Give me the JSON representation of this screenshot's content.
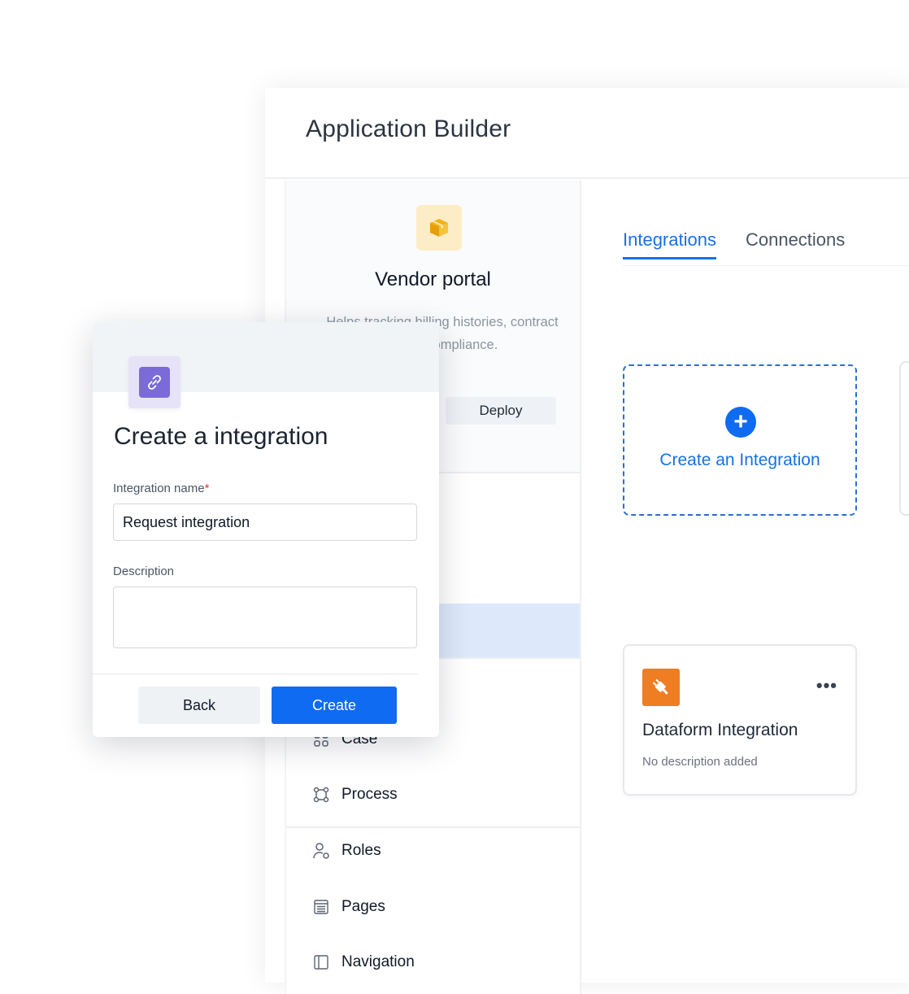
{
  "app": {
    "title": "Application Builder",
    "name": "Vendor portal",
    "description": "Helps tracking billing histories, contract ... Regulatory Compliance.",
    "description_line1": "Helps tracking billing histories, contract",
    "description_line2": "latory Compliance.",
    "deploy_label": "Deploy",
    "icon": "package-icon"
  },
  "sidebar": {
    "items": [
      {
        "label": "Case",
        "icon": "case-grid-icon"
      },
      {
        "label": "Process",
        "icon": "process-nodes-icon"
      },
      {
        "label": "Roles",
        "icon": "roles-user-icon"
      },
      {
        "label": "Pages",
        "icon": "pages-list-icon"
      },
      {
        "label": "Navigation",
        "icon": "navigation-icon"
      }
    ]
  },
  "main": {
    "tabs": [
      {
        "label": "Integrations",
        "active": true
      },
      {
        "label": "Connections",
        "active": false
      }
    ],
    "create_card": {
      "label": "Create an Integration",
      "icon": "plus-circle-icon"
    },
    "integrations": [
      {
        "name": "Dataform Integration",
        "description": "No description added",
        "icon": "plug-icon",
        "menu": "•••"
      }
    ]
  },
  "modal": {
    "title": "Create a integration",
    "icon": "link-icon",
    "fields": {
      "name_label": "Integration name",
      "required_mark": "*",
      "name_value": "Request integration",
      "description_label": "Description",
      "description_value": ""
    },
    "back_label": "Back",
    "create_label": "Create"
  },
  "colors": {
    "accent": "#0f6bf1",
    "link": "#1771e6",
    "integration_logo": "#ef7d22",
    "app_icon_bg": "#fdedc6",
    "modal_icon": "#7b6bd8",
    "sidebar_active": "#dde9fb"
  }
}
